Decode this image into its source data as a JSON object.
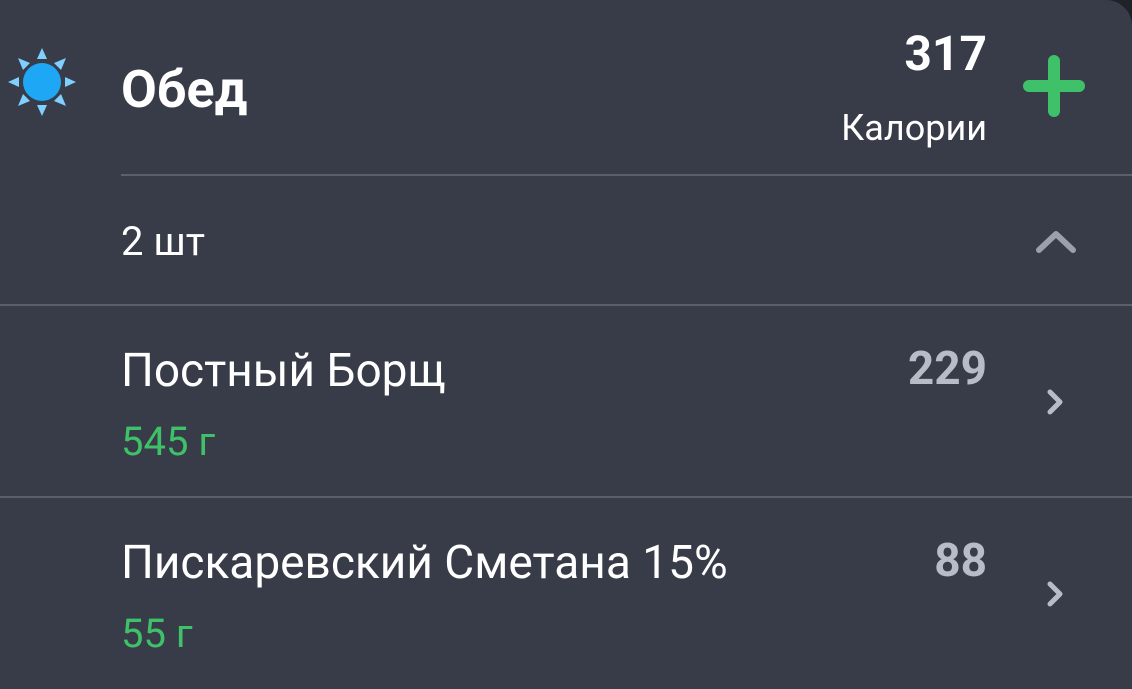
{
  "meal": {
    "icon": "sun-icon",
    "title": "Обед",
    "total_calories": "317",
    "calories_label": "Калории",
    "add_icon": "plus-icon",
    "item_count": "2 шт",
    "collapse_icon": "chevron-up-icon"
  },
  "foods": [
    {
      "name": "Постный Борщ",
      "weight": "545 г",
      "calories": "229"
    },
    {
      "name": "Пискаревский Сметана 15%",
      "weight": "55 г",
      "calories": "88"
    }
  ],
  "colors": {
    "background": "#383c48",
    "accent_green": "#3fc16a",
    "sun_blue": "#1ea7f5",
    "muted_text": "#b8bcc6",
    "divider": "#5c606c"
  }
}
